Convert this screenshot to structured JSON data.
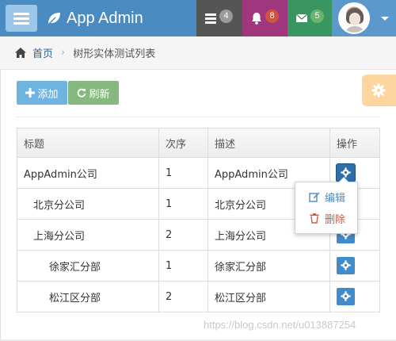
{
  "header": {
    "brand": "App Admin",
    "tasks_count": "4",
    "notifications_count": "8",
    "messages_count": "5"
  },
  "breadcrumb": {
    "home": "首页",
    "separator": "›",
    "current": "树形实体测试列表"
  },
  "toolbar": {
    "add_label": "添加",
    "refresh_label": "刷新"
  },
  "table": {
    "columns": [
      "标题",
      "次序",
      "描述",
      "操作"
    ],
    "rows": [
      {
        "title": "AppAdmin公司",
        "order": "1",
        "desc": "AppAdmin公司"
      },
      {
        "title": "北京分公司",
        "order": "1",
        "desc": "北京分公司"
      },
      {
        "title": "上海分公司",
        "order": "2",
        "desc": "上海分公司"
      },
      {
        "title": "徐家汇分部",
        "order": "1",
        "desc": "徐家汇分部"
      },
      {
        "title": "松江区分部",
        "order": "2",
        "desc": "松江区分部"
      }
    ]
  },
  "dropdown": {
    "edit_label": "编辑",
    "delete_label": "删除"
  },
  "watermark": "https://blog.csdn.net/u013887254",
  "colors": {
    "navbar": "#4a8bc2",
    "tasks": "#555555",
    "notifications": "#a0377e",
    "messages": "#3a9660",
    "primary_button": "#428bca",
    "add_button": "#6fb3e0",
    "refresh_button": "#87b87f",
    "settings_button": "#fcd59f",
    "delete_text": "#d15b47"
  },
  "icons": {
    "menu": "hamburger-icon",
    "brand": "leaf-icon",
    "tasks": "tasks-icon",
    "notifications": "bell-icon",
    "messages": "envelope-icon",
    "home": "home-icon",
    "add": "plus-icon",
    "refresh": "refresh-icon",
    "settings": "gear-icon",
    "edit": "edit-icon",
    "delete": "trash-icon"
  }
}
